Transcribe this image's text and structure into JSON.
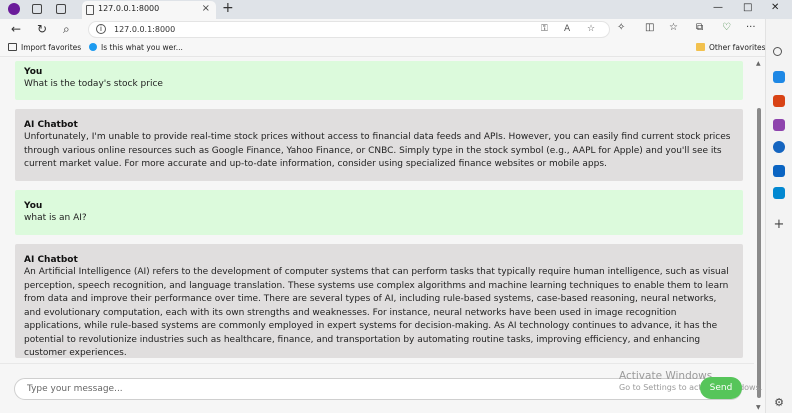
{
  "browser": {
    "tab_title": "127.0.0.1:8000",
    "new_tab_label": "+",
    "url": "127.0.0.1:8000",
    "back_icon": "←",
    "refresh_icon": "↻",
    "search_icon": "⌕",
    "close_tab_icon": "×",
    "minimize_icon": "—",
    "maximize_icon": "□",
    "close_window_icon": "✕",
    "more_icon": "···"
  },
  "favorites": {
    "import": "Import favorites",
    "bookmark": "Is this what you wer...",
    "other": "Other favorites"
  },
  "chat": {
    "messages": [
      {
        "sender": "You",
        "role": "user",
        "text": "What is the today's stock price"
      },
      {
        "sender": "AI Chatbot",
        "role": "bot",
        "text": "Unfortunately, I'm unable to provide real-time stock prices without access to financial data feeds and APIs. However, you can easily find current stock prices through various online resources such as Google Finance, Yahoo Finance, or CNBC. Simply type in the stock symbol (e.g., AAPL for Apple) and you'll see its current market value. For more accurate and up-to-date information, consider using specialized finance websites or mobile apps."
      },
      {
        "sender": "You",
        "role": "user",
        "text": "what is an AI?"
      },
      {
        "sender": "AI Chatbot",
        "role": "bot",
        "text": "An Artificial Intelligence (AI) refers to the development of computer systems that can perform tasks that typically require human intelligence, such as visual perception, speech recognition, and language translation. These systems use complex algorithms and machine learning techniques to enable them to learn from data and improve their performance over time. There are several types of AI, including rule-based systems, case-based reasoning, neural networks, and evolutionary computation, each with its own strengths and weaknesses. For instance, neural networks have been used in image recognition applications, while rule-based systems are commonly employed in expert systems for decision-making. As AI technology continues to advance, it has the potential to revolutionize industries such as healthcare, finance, and transportation by automating routine tasks, improving efficiency, and enhancing customer experiences."
      }
    ],
    "input_placeholder": "Type your message...",
    "input_value": "",
    "send_label": "Send"
  },
  "watermark": {
    "line1": "Activate Windows",
    "line2": "Go to Settings to activate Windows."
  },
  "colors": {
    "user_bubble": "#dcfadc",
    "bot_bubble": "#e0dede",
    "send_button": "#56c55a"
  }
}
